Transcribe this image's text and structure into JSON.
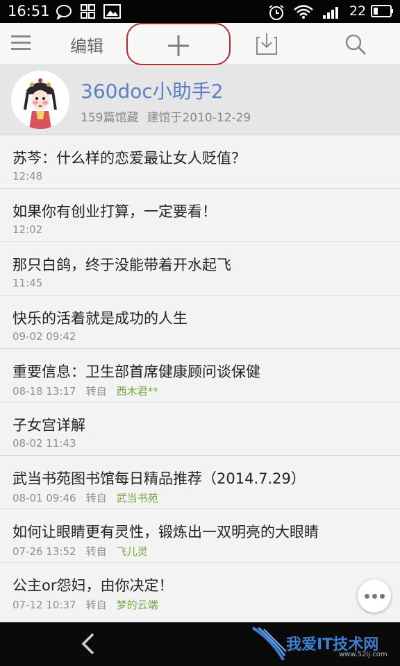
{
  "status_bar": {
    "time": "16:51",
    "battery_level": "22",
    "icons": [
      "chat-bubble-icon",
      "grid-icon",
      "image-icon",
      "alarm-icon",
      "wifi-icon",
      "signal-icon",
      "battery-icon"
    ]
  },
  "toolbar": {
    "edit_label": "编辑",
    "icons": [
      "menu-icon",
      "add-icon",
      "download-icon",
      "search-icon"
    ],
    "highlight_color": "#b8292f"
  },
  "profile": {
    "name": "360doc小助手2",
    "collection_count": "159篇馆藏",
    "created": "建馆于2010-12-29"
  },
  "articles": [
    {
      "title": "苏芩：什么样的恋爱最让女人贬值？",
      "time": "12:48",
      "via": "",
      "source": ""
    },
    {
      "title": "如果你有创业打算，一定要看！",
      "time": "12:02",
      "via": "",
      "source": ""
    },
    {
      "title": "那只白鸽，终于没能带着开水起飞",
      "time": "11:45",
      "via": "",
      "source": ""
    },
    {
      "title": "快乐的活着就是成功的人生",
      "time": "09-02 09:42",
      "via": "",
      "source": ""
    },
    {
      "title": "重要信息：卫生部首席健康顾问谈保健",
      "time": "08-18 13:17",
      "via": "转自",
      "source": "西木君**"
    },
    {
      "title": "子女宫详解",
      "time": "08-02 11:43",
      "via": "",
      "source": ""
    },
    {
      "title": "武当书苑图书馆每日精品推荐（2014.7.29）",
      "time": "08-01 09:46",
      "via": "转自",
      "source": "武当书苑"
    },
    {
      "title": "如何让眼睛更有灵性，锻炼出一双明亮的大眼睛",
      "time": "07-26 13:52",
      "via": "转自",
      "source": "飞儿灵"
    },
    {
      "title": "公主or怨妇，由你决定！",
      "time": "07-12 10:37",
      "via": "转自",
      "source": "梦的云端"
    }
  ],
  "watermark": {
    "text": "我爱IT技术网",
    "url": "www.52ij.com"
  }
}
